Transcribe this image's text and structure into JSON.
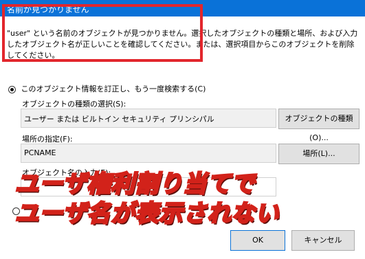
{
  "dialog": {
    "title": "名前が見つかりません",
    "message": "\"user\" という名前のオブジェクトが見つかりません。選択したオブジェクトの種類と場所、および入力したオブジェクト名が正しいことを確認してください。または、選択項目からこのオブジェクトを削除してください。"
  },
  "option": {
    "label": "このオブジェクト情報を訂正し、もう一度検索する(C)"
  },
  "object_type": {
    "label": "オブジェクトの種類の選択(S):",
    "value": "ユーザー または ビルトイン セキュリティ プリンシパル",
    "button": "オブジェクトの種類(O)..."
  },
  "location": {
    "label": "場所の指定(F):",
    "value": "PCNAME",
    "button": "場所(L)..."
  },
  "object_name": {
    "label": "オブジェクト名の入力(E):"
  },
  "buttons": {
    "ok": "OK",
    "cancel": "キャンセル"
  },
  "overlay": {
    "line1": "ユーザ権利割り当てで",
    "line2": "ユーザ名が表示されない",
    "text_color": "#f5e44a",
    "outline_color": "#d2221a"
  },
  "colors": {
    "titlebar": "#0a72d8",
    "highlight_border": "#e2262c"
  }
}
